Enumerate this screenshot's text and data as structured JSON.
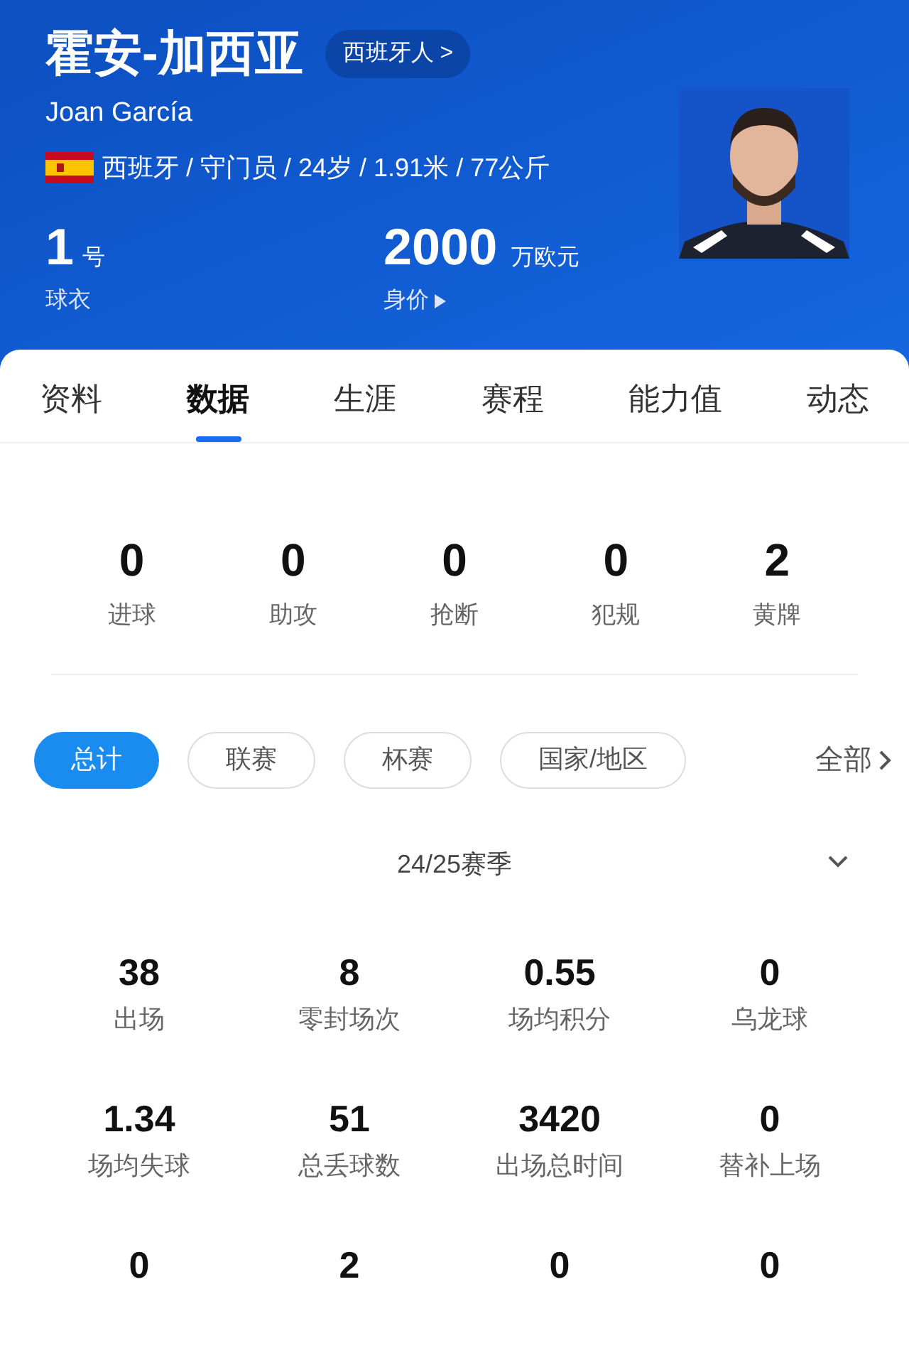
{
  "header": {
    "name_cn": "霍安-加西亚",
    "nationality_link": "西班牙人 >",
    "name_en": "Joan García",
    "info": "西班牙 / 守门员 / 24岁 / 1.91米 / 77公斤",
    "shirt": {
      "value": "1",
      "unit": "号",
      "label": "球衣"
    },
    "market_value": {
      "value": "2000",
      "unit": "万欧元",
      "label": "身价"
    }
  },
  "tabs": [
    {
      "label": "资料",
      "selected": false
    },
    {
      "label": "数据",
      "selected": true
    },
    {
      "label": "生涯",
      "selected": false
    },
    {
      "label": "赛程",
      "selected": false
    },
    {
      "label": "能力值",
      "selected": false
    },
    {
      "label": "动态",
      "selected": false
    }
  ],
  "summary": [
    {
      "value": "0",
      "label": "进球"
    },
    {
      "value": "0",
      "label": "助攻"
    },
    {
      "value": "0",
      "label": "抢断"
    },
    {
      "value": "0",
      "label": "犯规"
    },
    {
      "value": "2",
      "label": "黄牌"
    }
  ],
  "filters": [
    {
      "label": "总计",
      "selected": true
    },
    {
      "label": "联赛",
      "selected": false
    },
    {
      "label": "杯赛",
      "selected": false
    },
    {
      "label": "国家/地区",
      "selected": false
    }
  ],
  "filter_all": "全部",
  "season": "24/25赛季",
  "stats": [
    {
      "value": "38",
      "label": "出场"
    },
    {
      "value": "8",
      "label": "零封场次"
    },
    {
      "value": "0.55",
      "label": "场均积分"
    },
    {
      "value": "0",
      "label": "乌龙球"
    },
    {
      "value": "1.34",
      "label": "场均失球"
    },
    {
      "value": "51",
      "label": "总丢球数"
    },
    {
      "value": "3420",
      "label": "出场总时间"
    },
    {
      "value": "0",
      "label": "替补上场"
    },
    {
      "value": "0"
    },
    {
      "value": "2"
    },
    {
      "value": "0"
    },
    {
      "value": "0"
    }
  ]
}
